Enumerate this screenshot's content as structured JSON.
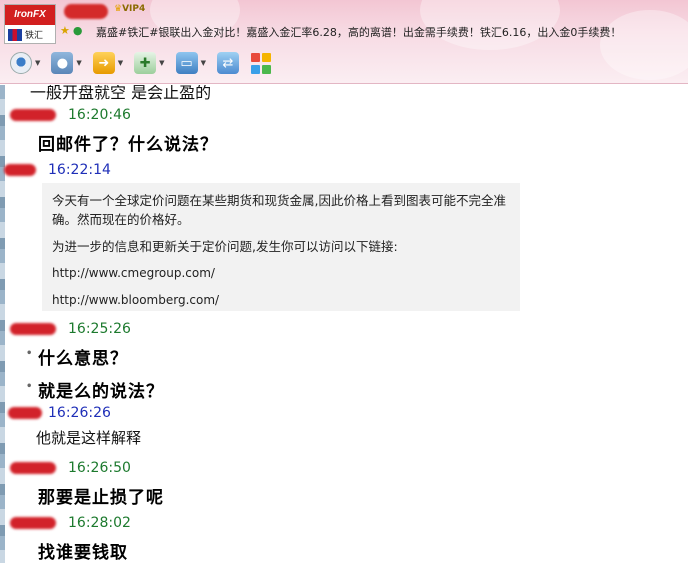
{
  "header": {
    "logo_text": "IronFX",
    "logo_sub": "铁汇",
    "vip_label": "VIP4",
    "signature": "嘉盛#铁汇#银联出入金对比！嘉盛入金汇率6.28，高的离谱！出金需手续费！铁汇6.16，出入金0手续费！",
    "toolbar": [
      {
        "name": "video-call",
        "icon": "webcam-icon"
      },
      {
        "name": "voice-call",
        "icon": "microphone-icon"
      },
      {
        "name": "share-screen",
        "icon": "share-icon"
      },
      {
        "name": "send-file",
        "icon": "file-icon"
      },
      {
        "name": "remote-assist",
        "icon": "screen-icon"
      },
      {
        "name": "remote-desktop",
        "icon": "remote-icon"
      },
      {
        "name": "apps",
        "icon": "apps-grid-icon"
      }
    ]
  },
  "chat": {
    "clipped_top_text": "一般开盘就空 是会止盈的",
    "messages": [
      {
        "time": "16:20:46",
        "side": "me",
        "text": "回邮件了？什么说法？"
      },
      {
        "time": "16:22:14",
        "side": "peer",
        "quote": {
          "line1": "今天有一个全球定价问题在某些期货和现货金属,因此价格上看到图表可能不完全准确。然而现在的价格好。",
          "line2": "为进一步的信息和更新关于定价问题,发生你可以访问以下链接:",
          "link1": "http://www.cmegroup.com/",
          "link2": "http://www.bloomberg.com/"
        }
      },
      {
        "time": "16:25:26",
        "side": "me",
        "lines": [
          "什么意思？",
          "就是么的说法？"
        ]
      },
      {
        "time": "16:26:26",
        "side": "peer",
        "text": "他就是这样解释"
      },
      {
        "time": "16:26:50",
        "side": "me",
        "text": "那要是止损了呢"
      },
      {
        "time": "16:28:02",
        "side": "me",
        "text": "找谁要钱取"
      }
    ]
  }
}
